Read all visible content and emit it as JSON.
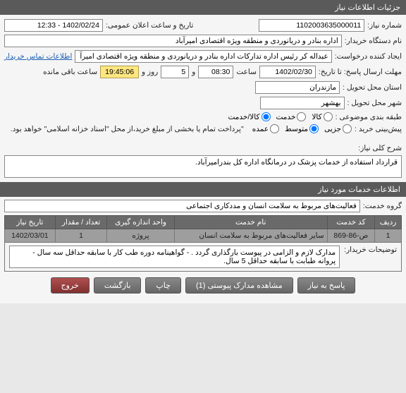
{
  "headers": {
    "main": "جزئیات اطلاعات نیاز"
  },
  "fields": {
    "need_no_label": "شماره نیاز:",
    "need_no": "1102003635000011",
    "announce_label": "تاریخ و ساعت اعلان عمومی:",
    "announce_value": "1402/02/24 - 12:33",
    "buyer_label": "نام دستگاه خریدار:",
    "buyer_value": "اداره بنادر و دریانوردی و منطقه ویژه اقتصادی امیرآباد",
    "creator_label": "ایجاد کننده درخواست:",
    "creator_value": "عبداله کر رئیس اداره تدارکات اداره بنادر و دریانوردی و منطقه ویژه اقتصادی امیرآ",
    "contact_link": "اطلاعات تماس خریدار",
    "deadline_label": "مهلت ارسال پاسخ: تا تاریخ:",
    "deadline_date": "1402/02/30",
    "time_label": "ساعت",
    "deadline_time": "08:30",
    "and_label": "و",
    "days": "5",
    "days_label": "روز و",
    "countdown": "19:45:06",
    "remaining_label": "ساعت باقی مانده",
    "province_label": "استان محل تحویل :",
    "province_value": "مازندران",
    "city_label": "شهر محل تحویل :",
    "city_value": "بهشهر",
    "subject_label": "طبقه بندی موضوعی :",
    "purchase_label": "پیش‌بینی خرید :",
    "payment_note": "\"پرداخت تمام یا بخشی از مبلغ خرید،از محل \"اسناد خزانه اسلامی\" خواهد بود.",
    "subject_opts": {
      "goods": "کالا",
      "service": "خدمت",
      "both": "کالا/خدمت"
    },
    "purchase_opts": {
      "partial": "جزیی",
      "medium": "متوسط",
      "bulk": "عمده"
    }
  },
  "sections": {
    "desc_label": "شرح کلی نیاز:",
    "desc_value": "قرارداد استفاده از خدمات پزشک در درمانگاه اداره کل بندرامیرآباد.",
    "services_header": "اطلاعات خدمات مورد نیاز",
    "group_label": "گروه خدمت:",
    "group_value": "فعالیت‌های مربوط به سلامت انسان و مددکاری اجتماعی",
    "notes_label": "توضیحات خریدار:",
    "notes_value": "مدارک لازم و الزامی در پیوست بارگذاری گردد . - گواهینامه دوره طب کار با سابقه حداقل سه سال - پروانه طبابت با سابقه حداقل 5 سال."
  },
  "table": {
    "cols": {
      "row": "ردیف",
      "code": "کد خدمت",
      "name": "نام خدمت",
      "unit": "واحد اندازه گیری",
      "qty": "تعداد / مقدار",
      "date": "تاریخ نیاز"
    },
    "rows": [
      {
        "row": "1",
        "code": "ص-86-869",
        "name": "سایر فعالیت‌های مربوط به سلامت انسان",
        "unit": "پروژه",
        "qty": "1",
        "date": "1402/03/01"
      }
    ]
  },
  "buttons": {
    "respond": "پاسخ به نیاز",
    "attachments": "مشاهده مدارک پیوستی (1)",
    "print": "چاپ",
    "back": "بازگشت",
    "exit": "خروج"
  }
}
